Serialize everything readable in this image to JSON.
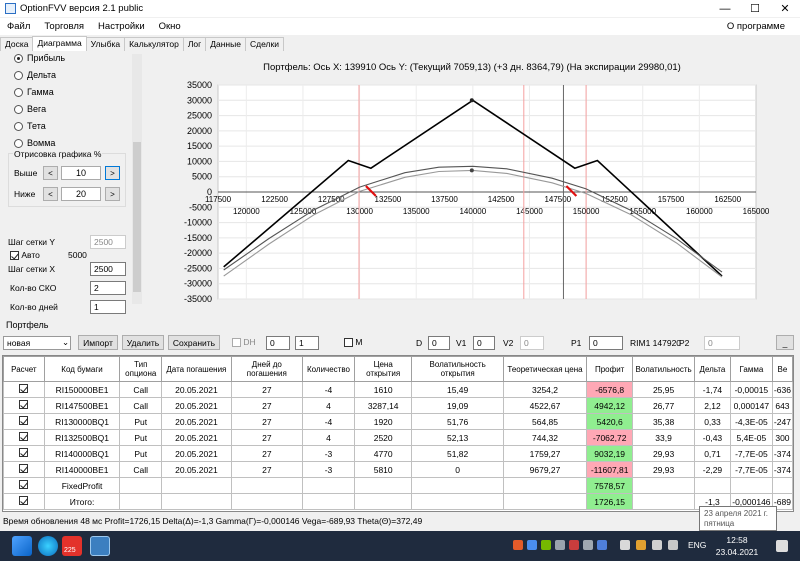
{
  "window": {
    "title": "OptionFVV версия 2.1 public",
    "min": "—",
    "max": "☐",
    "close": "✕"
  },
  "menu": {
    "items": [
      "Файл",
      "Торговля",
      "Настройки",
      "Окно"
    ],
    "about": "О программе"
  },
  "tabs": [
    "Доска",
    "Диаграмма",
    "Улыбка",
    "Калькулятор",
    "Лог",
    "Данные",
    "Сделки"
  ],
  "active_tab": "Диаграмма",
  "left": {
    "radios": [
      "Прибыль",
      "Дельта",
      "Гамма",
      "Вега",
      "Тета",
      "Вомма"
    ],
    "selected": "Прибыль",
    "group_title": "Отрисовка графика %",
    "above_label": "Выше",
    "above_value": "10",
    "below_label": "Ниже",
    "below_value": "20",
    "dec": "<",
    "inc": ">",
    "grid_y_label": "Шаг сетки Y",
    "grid_y_value": "2500",
    "auto_label": "Авто",
    "auto_value": "5000",
    "grid_x_label": "Шаг сетки X",
    "grid_x_value": "2500",
    "sko_label": "Кол-во СКО",
    "sko_value": "2",
    "days_label": "Кол-во дней",
    "days_value": "1"
  },
  "chart_header": "Портфель: Ось X: 139910 Ось Y:  (Текущий 7059,13)  (+3 дн. 8364,79)  (На экспирации 29980,01)",
  "chart_data": {
    "type": "line",
    "title": "Портфель: Ось X: 139910 Ось Y:  (Текущий 7059,13)  (+3 дн. 8364,79)  (На экспирации 29980,01)",
    "xlim": [
      117500,
      165000
    ],
    "ylim": [
      -35000,
      35000
    ],
    "x_ticks_top": [
      "117500",
      "122500",
      "127500",
      "132500",
      "137500",
      "142500",
      "147500",
      "152500",
      "157500",
      "162500"
    ],
    "x_ticks_bottom": [
      "120000",
      "125000",
      "130000",
      "135000",
      "140000",
      "145000",
      "150000",
      "155000",
      "160000",
      "165000"
    ],
    "y_ticks": [
      "35000",
      "30000",
      "25000",
      "20000",
      "15000",
      "10000",
      "5000",
      "0",
      "-5000",
      "-10000",
      "-15000",
      "-20000",
      "-25000",
      "-30000",
      "-35000"
    ],
    "grid": true,
    "series": [
      {
        "points": [
          [
            118000,
            -24500
          ],
          [
            129000,
            10300
          ],
          [
            131000,
            7800
          ],
          [
            140000,
            30000
          ],
          [
            149000,
            7800
          ],
          [
            151000,
            10300
          ],
          [
            162000,
            -27500
          ]
        ],
        "color": "#000000"
      },
      {
        "points": [
          [
            118000,
            -25500
          ],
          [
            122000,
            -15200
          ],
          [
            126000,
            -5800
          ],
          [
            130000,
            1600
          ],
          [
            134000,
            6300
          ],
          [
            137000,
            8100
          ],
          [
            140000,
            8400
          ],
          [
            143000,
            7600
          ],
          [
            147000,
            4500
          ],
          [
            150000,
            1000
          ],
          [
            154000,
            -6100
          ],
          [
            158000,
            -15300
          ],
          [
            162000,
            -26200
          ]
        ],
        "color": "#555555"
      },
      {
        "points": [
          [
            118000,
            -27500
          ],
          [
            122000,
            -17000
          ],
          [
            126000,
            -7400
          ],
          [
            130000,
            200
          ],
          [
            134000,
            4800
          ],
          [
            137000,
            6700
          ],
          [
            140000,
            7059
          ],
          [
            143000,
            6100
          ],
          [
            147000,
            3000
          ],
          [
            150000,
            -500
          ],
          [
            154000,
            -7500
          ],
          [
            158000,
            -16700
          ],
          [
            162000,
            -27800
          ]
        ],
        "color": "#999999"
      }
    ],
    "current_x": 139910,
    "vertical_markers": {
      "red": [
        129950,
        144500,
        150000
      ],
      "gray": 148000
    },
    "red_strokes": [
      [
        131000,
        0
      ],
      [
        148700,
        0
      ]
    ]
  },
  "portfolio": {
    "title": "Портфель",
    "select": "новая",
    "import": "Импорт",
    "delete": "Удалить",
    "save": "Сохранить",
    "dh": "DH",
    "dh_v1": "0",
    "dh_v2": "1",
    "m": "M",
    "d_label": "D",
    "d_value": "0",
    "v1_label": "V1",
    "v1_value": "0",
    "v2_label": "V2",
    "v2_value": "0",
    "p1_label": "P1",
    "p1_value": "0",
    "rim_label": "RIM1 147920",
    "p2_label": "P2",
    "p2_value": "0",
    "extra_button": "_"
  },
  "table": {
    "headers": [
      "Расчет",
      "Код бумаги",
      "Тип опциона",
      "Дата погашения",
      "Дней до погашения",
      "Количество",
      "Цена открытия",
      "Волатильность открытия",
      "Теоретическая цена",
      "Профит",
      "Волатильность",
      "Дельта",
      "Гамма",
      "Ве"
    ],
    "rows": [
      [
        "RI150000BE1",
        "Call",
        "20.05.2021",
        "27",
        "-4",
        "1610",
        "15,49",
        "3254,2",
        "-6576,8",
        "25,95",
        "-1,74",
        "-0,00015",
        "-636"
      ],
      [
        "RI147500BE1",
        "Call",
        "20.05.2021",
        "27",
        "4",
        "3287,14",
        "19,09",
        "4522,67",
        "4942,12",
        "26,77",
        "2,12",
        "0,000147",
        "643"
      ],
      [
        "RI130000BQ1",
        "Put",
        "20.05.2021",
        "27",
        "-4",
        "1920",
        "51,76",
        "564,85",
        "5420,6",
        "35,38",
        "0,33",
        "-4,3E-05",
        "-247"
      ],
      [
        "RI132500BQ1",
        "Put",
        "20.05.2021",
        "27",
        "4",
        "2520",
        "52,13",
        "744,32",
        "-7062,72",
        "33,9",
        "-0,43",
        "5,4E-05",
        "300"
      ],
      [
        "RI140000BQ1",
        "Put",
        "20.05.2021",
        "27",
        "-3",
        "4770",
        "51,82",
        "1759,27",
        "9032,19",
        "29,93",
        "0,71",
        "-7,7E-05",
        "-374"
      ],
      [
        "RI140000BE1",
        "Call",
        "20.05.2021",
        "27",
        "-3",
        "5810",
        "0",
        "9679,27",
        "-11607,81",
        "29,93",
        "-2,29",
        "-7,7E-05",
        "-374"
      ]
    ],
    "profit_sign": [
      "neg",
      "pos",
      "pos",
      "neg",
      "pos",
      "neg"
    ],
    "fixed_label": "FixedProfit",
    "fixed_value": "7578,57",
    "total_label": "Итого:",
    "total_profit": "1726,15",
    "total_delta": "-1,3",
    "total_gamma": "-0,000146",
    "total_vega": "-689"
  },
  "status": "Время обновления 48 мс  Profit=1726,15 Delta(Δ)=-1,3 Gamma(Γ)=-0,000146 Vega=-689,93 Theta(Θ)=372,49",
  "tooltip": {
    "line1": "23 апреля 2021 г.",
    "line2": "пятница"
  },
  "taskbar": {
    "badge": "225",
    "lang": "ENG",
    "time": "12:58",
    "date": "23.04.2021"
  }
}
